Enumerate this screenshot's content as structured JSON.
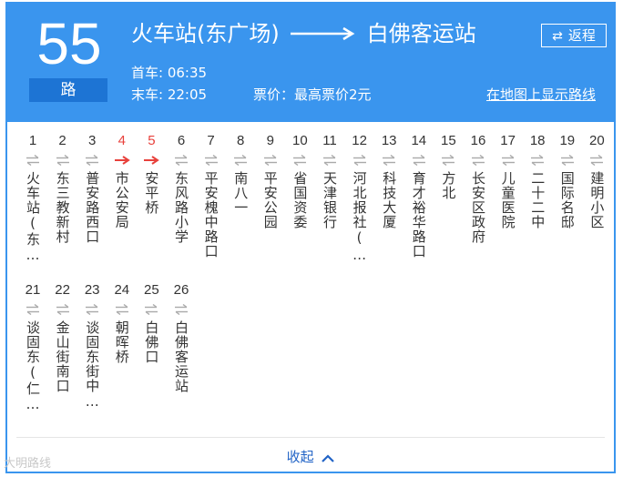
{
  "header": {
    "route_number": "55",
    "route_suffix": "路",
    "origin": "火车站(东广场)",
    "destination": "白佛客运站",
    "return_label": "返程",
    "first_bus_label": "首车:",
    "first_bus_time": "06:35",
    "last_bus_label": "末车:",
    "last_bus_time": "22:05",
    "fare": "票价：最高票价2元",
    "map_link": "在地图上显示路线"
  },
  "stops": [
    {
      "num": "1",
      "name": "火车站(东…",
      "active": false
    },
    {
      "num": "2",
      "name": "东三教新村",
      "active": false
    },
    {
      "num": "3",
      "name": "普安路西口",
      "active": false
    },
    {
      "num": "4",
      "name": "市公安局",
      "active": true
    },
    {
      "num": "5",
      "name": "安平桥",
      "active": true
    },
    {
      "num": "6",
      "name": "东风路小学",
      "active": false
    },
    {
      "num": "7",
      "name": "平安槐中路口",
      "active": false
    },
    {
      "num": "8",
      "name": "南八一",
      "active": false
    },
    {
      "num": "9",
      "name": "平安公园",
      "active": false
    },
    {
      "num": "10",
      "name": "省国资委",
      "active": false
    },
    {
      "num": "11",
      "name": "天津银行",
      "active": false
    },
    {
      "num": "12",
      "name": "河北报社(…",
      "active": false
    },
    {
      "num": "13",
      "name": "科技大厦",
      "active": false
    },
    {
      "num": "14",
      "name": "育才裕华路口",
      "active": false
    },
    {
      "num": "15",
      "name": "方北",
      "active": false
    },
    {
      "num": "16",
      "name": "长安区政府",
      "active": false
    },
    {
      "num": "17",
      "name": "儿童医院",
      "active": false
    },
    {
      "num": "18",
      "name": "二十二中",
      "active": false
    },
    {
      "num": "19",
      "name": "国际名邸",
      "active": false
    },
    {
      "num": "20",
      "name": "建明小区",
      "active": false
    },
    {
      "num": "21",
      "name": "谈固东(仁…",
      "active": false
    },
    {
      "num": "22",
      "name": "金山街南口",
      "active": false
    },
    {
      "num": "23",
      "name": "谈固东街中…",
      "active": false
    },
    {
      "num": "24",
      "name": "朝晖桥",
      "active": false
    },
    {
      "num": "25",
      "name": "白佛口",
      "active": false
    },
    {
      "num": "26",
      "name": "白佛客运站",
      "active": false
    }
  ],
  "footer": {
    "collapse_label": "收起",
    "watermark": "大明路线"
  },
  "colors": {
    "header_bg": "#3a95ee",
    "suffix_bg": "#1d74d4",
    "active_stop": "#e8413c",
    "link": "#2163c6"
  }
}
